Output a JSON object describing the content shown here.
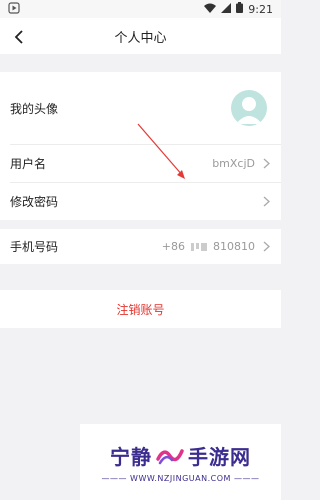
{
  "statusbar": {
    "time": "9:21"
  },
  "header": {
    "title": "个人中心"
  },
  "rows": {
    "avatar_label": "我的头像",
    "username_label": "用户名",
    "username_value": "bmXcjD",
    "password_label": "修改密码",
    "phone_label": "手机号码",
    "phone_prefix": "+86",
    "phone_value": "810810"
  },
  "logout": {
    "label": "注销账号"
  },
  "watermark": {
    "left": "宁静",
    "right": "手游网",
    "url": "——— WWW.NZJINGUAN.COM ———"
  },
  "colors": {
    "accent_red": "#e5322d",
    "avatar_bg": "#bfe3de",
    "annotation_arrow": "#e53935"
  }
}
